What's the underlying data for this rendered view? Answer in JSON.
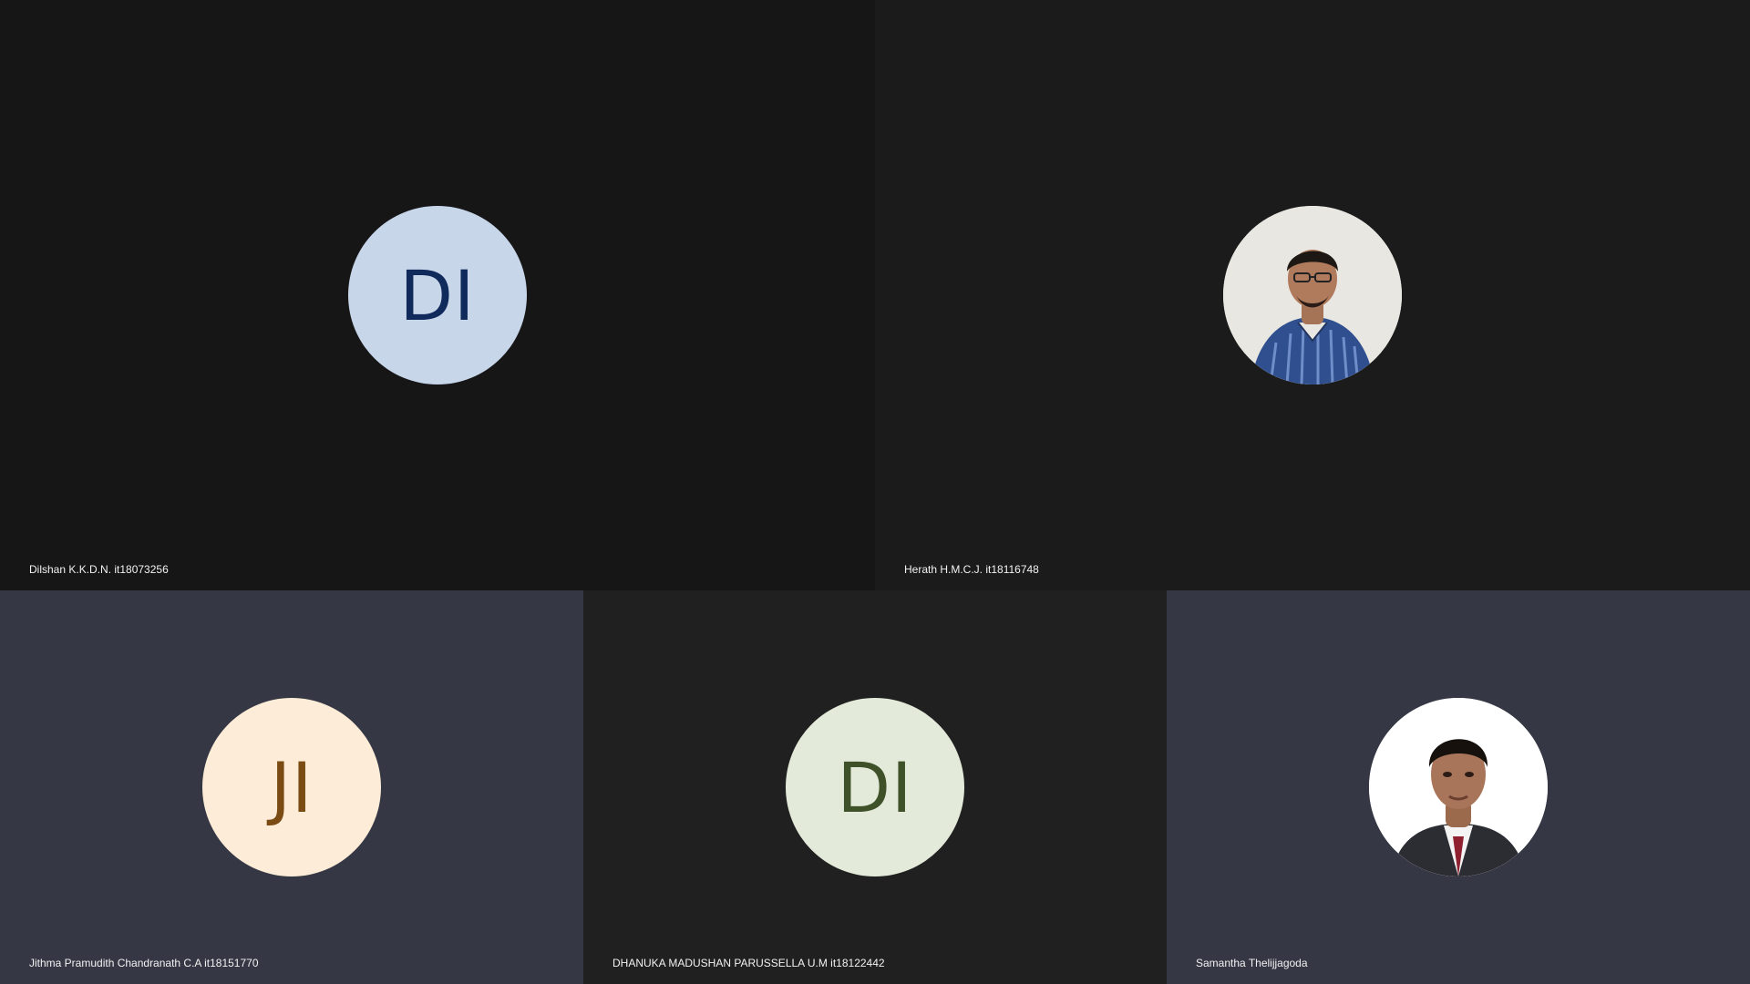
{
  "participants": [
    {
      "name": "Dilshan K.K.D.N. it18073256",
      "initials": "DI"
    },
    {
      "name": "Herath H.M.C.J. it18116748",
      "initials": ""
    },
    {
      "name": "Jithma Pramudith Chandranath C.A it18151770",
      "initials": "JI"
    },
    {
      "name": "DHANUKA MADUSHAN PARUSSELLA U.M it18122442",
      "initials": "DI"
    },
    {
      "name": "Samantha Thelijjagoda",
      "initials": ""
    }
  ],
  "colors": {
    "tile_dark": "#161617",
    "tile_slate": "#353745",
    "avatar_blue": "#c8d6ea",
    "avatar_peach": "#fdecd7",
    "avatar_green": "#e4ead9"
  },
  "icons": {
    "participant_2_photo": "person-photo-icon",
    "participant_5_photo": "person-photo-icon"
  }
}
